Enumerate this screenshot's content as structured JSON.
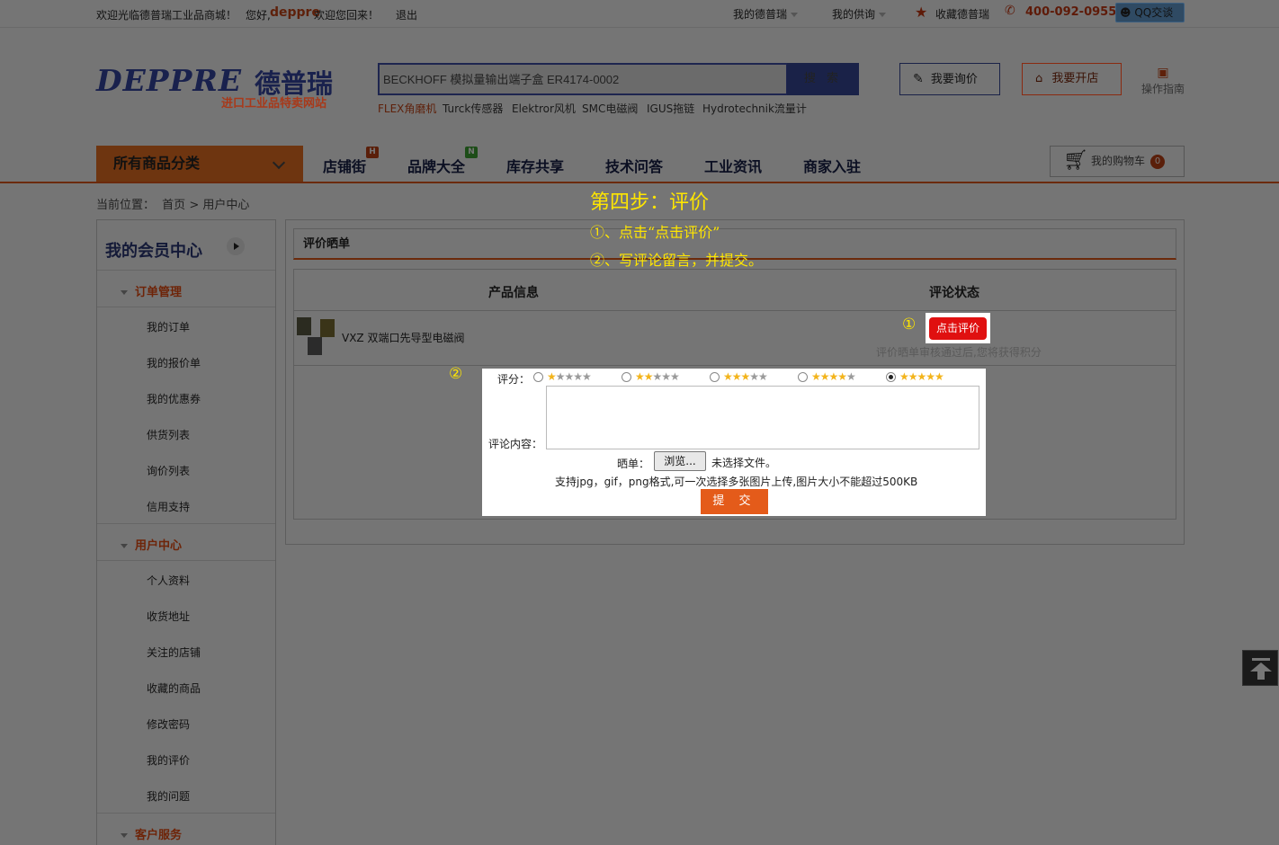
{
  "topbar": {
    "welcome": "欢迎光临德普瑞工业品商城！",
    "hello": "您好,",
    "username": "deppre",
    "welcome_back": "欢迎您回来！",
    "logout": "退出",
    "my_deppre": "我的德普瑞",
    "my_supply": "我的供询",
    "favorite": "收藏德普瑞",
    "phone": "400-092-0955",
    "qq": "QQ交谈"
  },
  "logo": {
    "brand_en": "DEPPRE",
    "brand_cn": "德普瑞",
    "slogan": "进口工业品特卖网站"
  },
  "search": {
    "placeholder": "BECKHOFF 模拟量输出端子盒 ER4174-0002",
    "button": "搜 索",
    "hot_words": [
      "FLEX角磨机",
      "Turck传感器",
      "Elektror风机",
      "SMC电磁阀",
      "IGUS拖链",
      "Hydrotechnik流量计"
    ]
  },
  "header_buttons": {
    "inquiry": "我要询价",
    "open_shop": "我要开店",
    "guide": "操作指南"
  },
  "nav": {
    "all_categories": "所有商品分类",
    "items": [
      "店铺街",
      "品牌大全",
      "库存共享",
      "技术问答",
      "工业资讯",
      "商家入驻"
    ],
    "badges": {
      "shops": "H",
      "brands": "N"
    },
    "cart_label": "我的购物车",
    "cart_count": "0"
  },
  "breadcrumb": {
    "prefix": "当前位置：",
    "home": "首页",
    "sep": ">",
    "current": "用户中心"
  },
  "sidebar": {
    "title": "我的会员中心",
    "sections": [
      {
        "title": "订单管理",
        "items": [
          "我的订单",
          "我的报价单",
          "我的优惠券",
          "供货列表",
          "询价列表",
          "信用支持"
        ]
      },
      {
        "title": "用户中心",
        "items": [
          "个人资料",
          "收货地址",
          "关注的店铺",
          "收藏的商品",
          "修改密码",
          "我的评价",
          "我的问题"
        ]
      },
      {
        "title": "客户服务",
        "items": []
      }
    ]
  },
  "main": {
    "panel_title": "评价晒单",
    "columns": [
      "产品信息",
      "评论状态"
    ],
    "product_name": "VXZ 双端口先导型电磁阀",
    "review_button": "点击评价",
    "review_hint": "评价晒单审核通过后,您将获得积分"
  },
  "annotation": {
    "step_title": "第四步：评价",
    "step_1": "①、点击“点击评价”",
    "step_2": "②、写评论留言，并提交。",
    "marker_1": "①",
    "marker_2": "②"
  },
  "review_form": {
    "rating_label": "评分：",
    "ratings": [
      1,
      2,
      3,
      4,
      5
    ],
    "selected_rating": 5,
    "content_label": "评论内容：",
    "content_value": "",
    "photo_label": "晒单：",
    "browse_button": "浏览...",
    "no_file": "未选择文件。",
    "tip": "支持jpg，gif，png格式,可一次选择多张图片上传,图片大小不能超过500KB",
    "submit": "提 交"
  },
  "colors": {
    "accent": "#e45b1a",
    "review_button": "#e01010",
    "annotation": "#ffe600",
    "navy": "#1a2248"
  }
}
